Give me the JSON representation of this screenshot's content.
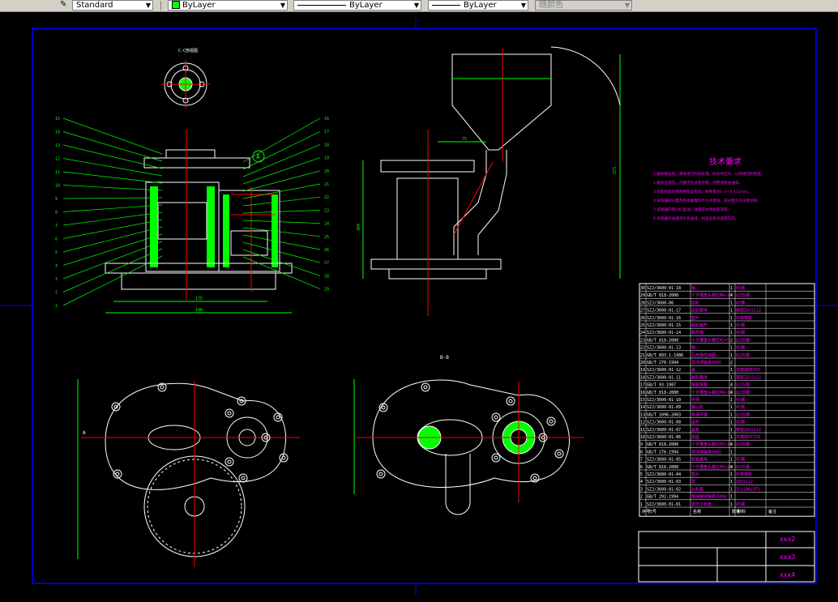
{
  "toolbar": {
    "text_style": "Standard",
    "layer": "ByLayer",
    "linetype": "ByLayer",
    "lineweight": "ByLayer",
    "color": "随颜色"
  },
  "drawing": {
    "section_cc": "C-C剖视图",
    "section_bb": "B-B",
    "tech_title": "技术要求",
    "tech_notes": [
      "1.箱体铸造后，需要进行时效处理，除去内应力，以改善切削性能。",
      "2.箱体应清洗，内部不允许有杂物，内壁涂耐油油漆。",
      "3.装配时齿轮侧隙用铅丝检验，侧隙值为0.3～0.415mm。",
      "4.减速器剖分面及各接触面均不允许漏油，剖分面允许涂密封胶。",
      "5.减速器内装CKC型油，油量应达到规定深度。",
      "6.减速器外表面涂灰色油漆，机盖处标识运转方向。"
    ],
    "parts": [
      {
        "no": "30",
        "code": "SZJ/3600-01-18",
        "name": "轴",
        "qty": "1",
        "material": "45钢"
      },
      {
        "no": "29",
        "code": "GB/T 818-2000",
        "name": "十字槽盘头螺钉M4×10",
        "qty": "4",
        "material": "Q235钢"
      },
      {
        "no": "28",
        "code": "SZJ/3600-06",
        "name": "齿轮",
        "qty": "1",
        "material": "45钢"
      },
      {
        "no": "27",
        "code": "SZJ/3600-01-17",
        "name": "齿轮箱体",
        "qty": "1",
        "material": "铸铝ZAlSi12"
      },
      {
        "no": "26",
        "code": "SZJ/3600-01-16",
        "name": "垫片",
        "qty": "1",
        "material": "石棉橡胶"
      },
      {
        "no": "25",
        "code": "SZJ/3600-01-15",
        "name": "蜗轮蜗杆",
        "qty": "1",
        "material": "45钢"
      },
      {
        "no": "24",
        "code": "SZJ/3600-01-14",
        "name": "蜗杆轴",
        "qty": "1",
        "material": "45钢"
      },
      {
        "no": "23",
        "code": "GB/T 818-2000",
        "name": "十字槽盘头螺钉M3×5",
        "qty": "2",
        "material": "Q235钢"
      },
      {
        "no": "22",
        "code": "SZJ/3600-01-13",
        "name": "轴",
        "qty": "1",
        "material": "45钢"
      },
      {
        "no": "21",
        "code": "GB/T 893.1-1986",
        "name": "孔用弹性挡圈",
        "qty": "1",
        "material": "Q235钢"
      },
      {
        "no": "20",
        "code": "GB/T 276-1994",
        "name": "深沟球轴承6005",
        "qty": "2",
        "material": ""
      },
      {
        "no": "19",
        "code": "SZJ/3600-01-12",
        "name": "盖",
        "qty": "1",
        "material": "灰铸铁HT150"
      },
      {
        "no": "18",
        "code": "SZJ/3600-01-11",
        "name": "蜗轮箱体",
        "qty": "1",
        "material": "铸铝ZAlSi12"
      },
      {
        "no": "17",
        "code": "GB/T 93-1987",
        "name": "弹簧垫圈",
        "qty": "4",
        "material": "Q235钢"
      },
      {
        "no": "16",
        "code": "GB/T 818-2000",
        "name": "十字槽盘头螺钉M4×10",
        "qty": "4",
        "material": "Q235钢"
      },
      {
        "no": "15",
        "code": "SZJ/3600-01-10",
        "name": "手柄",
        "qty": "1",
        "material": "45钢"
      },
      {
        "no": "14",
        "code": "SZJ/3600-01-09",
        "name": "偏心轮",
        "qty": "1",
        "material": "45钢"
      },
      {
        "no": "13",
        "code": "GB/T 1096-2003",
        "name": "普通平键",
        "qty": "1",
        "material": "Q235钢"
      },
      {
        "no": "12",
        "code": "SZJ/3600-01-08",
        "name": "连杆",
        "qty": "1",
        "material": "45钢"
      },
      {
        "no": "11",
        "code": "SZJ/3600-01-07",
        "name": "盖板",
        "qty": "1",
        "material": "铸铝ZAlSi12"
      },
      {
        "no": "10",
        "code": "SZJ/3600-01-06",
        "name": "底座",
        "qty": "1",
        "material": "灰铸铁HT150"
      },
      {
        "no": "9",
        "code": "GB/T 818-2000",
        "name": "十字槽盘头螺钉M3×10",
        "qty": "4",
        "material": "Q235钢"
      },
      {
        "no": "8",
        "code": "GB/T 276-1994",
        "name": "深沟球轴承6002",
        "qty": "1",
        "material": ""
      },
      {
        "no": "7",
        "code": "SZJ/3600-01-05",
        "name": "锁紧螺母",
        "qty": "1",
        "material": "45钢"
      },
      {
        "no": "6",
        "code": "GB/T 818-2000",
        "name": "十字槽盘头螺钉M3×10",
        "qty": "4",
        "material": "Q235钢"
      },
      {
        "no": "5",
        "code": "SZJ/3600-01-04",
        "name": "垫片",
        "qty": "1",
        "material": "石棉橡胶"
      },
      {
        "no": "4",
        "code": "SZJ/3600-01-03",
        "name": "罩",
        "qty": "1",
        "material": "ZAlSi12"
      },
      {
        "no": "3",
        "code": "SZJ/3600-01-02",
        "name": "分料盘",
        "qty": "1",
        "material": "1Cr18Ni9Ti"
      },
      {
        "no": "2",
        "code": "GB/T 292-1994",
        "name": "角接触球轴承7000C",
        "qty": "1",
        "material": ""
      },
      {
        "no": "1",
        "code": "SZJ/3600-01-01",
        "name": "调节下料盘",
        "qty": "1",
        "material": "45钢"
      }
    ],
    "header_labels": [
      "序号",
      "代号",
      "名称",
      "数量",
      "材料",
      "备注"
    ],
    "title_right": [
      "xxx2",
      "xxx3",
      "xxx4"
    ],
    "callouts_left": [
      "15",
      "14",
      "13",
      "12",
      "11",
      "10",
      "9",
      "8",
      "7",
      "6",
      "5",
      "4",
      "3",
      "2",
      "1"
    ],
    "callouts_right": [
      "16",
      "17",
      "18",
      "19",
      "20",
      "21",
      "22",
      "23",
      "24",
      "25",
      "26",
      "27",
      "28",
      "29"
    ],
    "dim_175": "175",
    "dim_196": "196",
    "dim_75": "75",
    "dim_373": "373",
    "dim_304": "304",
    "marker_A": "A"
  },
  "colors": {
    "frame": "#0000ff",
    "geometry": "#ffffff",
    "dimension": "#00ff00",
    "centerline": "#ff0000",
    "text": "#ff00ff",
    "hatch": "#00ff00"
  }
}
